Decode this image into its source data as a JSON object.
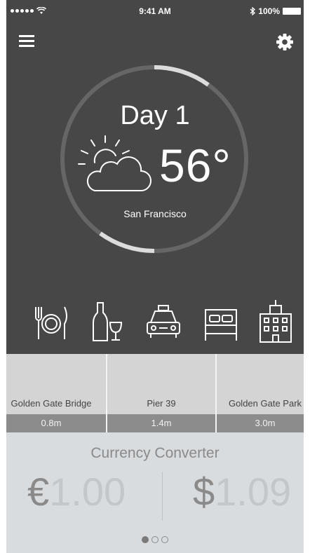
{
  "status_bar": {
    "time": "9:41 AM",
    "battery": "100%",
    "icons": [
      "signal-dots-icon",
      "wifi-icon",
      "bluetooth-icon",
      "battery-icon"
    ]
  },
  "header": {
    "menu_icon": "hamburger-menu-icon",
    "settings_icon": "gear-icon"
  },
  "weather": {
    "day_label": "Day 1",
    "temperature": "56°",
    "city": "San Francisco",
    "condition_icon": "partly-sunny-icon",
    "day_progress": 0.1
  },
  "categories": [
    {
      "icon": "dining-icon"
    },
    {
      "icon": "wine-bar-icon"
    },
    {
      "icon": "taxi-icon"
    },
    {
      "icon": "hotel-bed-icon"
    },
    {
      "icon": "building-icon"
    }
  ],
  "places": [
    {
      "name": "Golden Gate Bridge",
      "distance": "0.8m"
    },
    {
      "name": "Pier 39",
      "distance": "1.4m"
    },
    {
      "name": "Golden Gate Park",
      "distance": "3.0m"
    }
  ],
  "converter": {
    "title": "Currency Converter",
    "from_symbol": "€",
    "from_amount": "1.00",
    "to_symbol": "$",
    "to_amount": "1.09"
  },
  "pagination": {
    "total": 3,
    "active": 1
  },
  "colors": {
    "dark_bg": "#474747",
    "card_bg": "#d4d4d4",
    "distance_bar": "#8c8c8c",
    "converter_bg": "#d8dcdf",
    "ring_track": "#666666",
    "ring_progress": "#dcdcdc"
  }
}
